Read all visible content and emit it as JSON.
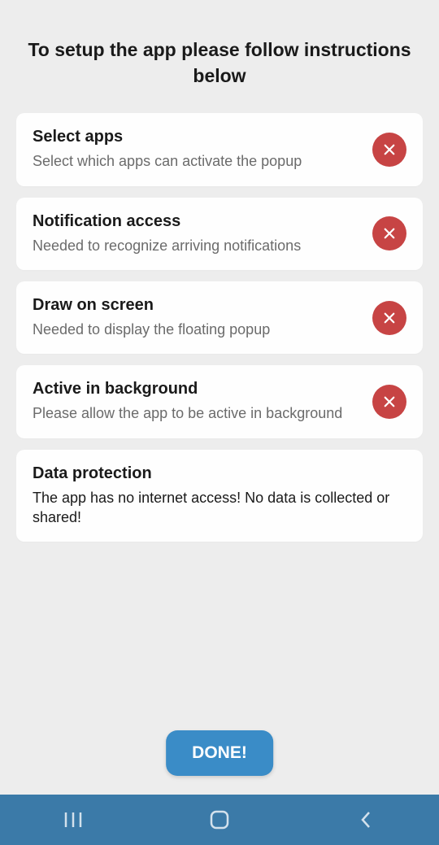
{
  "header": {
    "title": "To setup the app please follow instructions below"
  },
  "cards": [
    {
      "title": "Select apps",
      "desc": "Select which apps can activate the popup",
      "status": "close",
      "descDark": false
    },
    {
      "title": "Notification access",
      "desc": "Needed to recognize arriving notifications",
      "status": "close",
      "descDark": false
    },
    {
      "title": "Draw on screen",
      "desc": "Needed to display the floating popup",
      "status": "close",
      "descDark": false
    },
    {
      "title": "Active in background",
      "desc": "Please allow the app to be active in background",
      "status": "close",
      "descDark": false
    },
    {
      "title": "Data protection",
      "desc": "The app has no internet access! No data is collected or shared!",
      "status": "none",
      "descDark": true
    }
  ],
  "footer": {
    "done_label": "DONE!"
  },
  "colors": {
    "status_error": "#c74444",
    "accent": "#3a8cc7",
    "navbar": "#3b7aa8"
  }
}
